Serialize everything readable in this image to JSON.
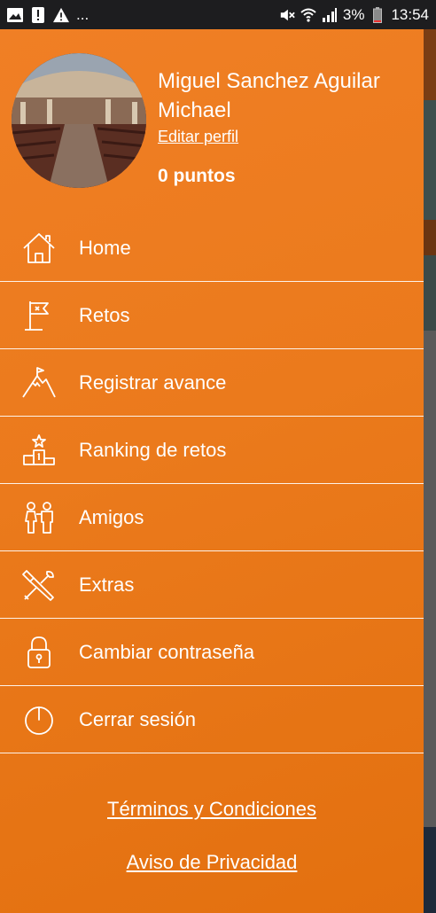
{
  "status_bar": {
    "battery": "3%",
    "time": "13:54",
    "ellipsis": "..."
  },
  "profile": {
    "name": "Miguel Sanchez Aguilar Michael",
    "edit_label": "Editar perfil",
    "points": "0 puntos"
  },
  "menu": [
    {
      "label": "Home",
      "icon": "home-icon"
    },
    {
      "label": "Retos",
      "icon": "flag-icon"
    },
    {
      "label": "Registrar avance",
      "icon": "mountain-icon"
    },
    {
      "label": "Ranking de retos",
      "icon": "podium-icon"
    },
    {
      "label": "Amigos",
      "icon": "friends-icon"
    },
    {
      "label": "Extras",
      "icon": "tools-icon"
    },
    {
      "label": "Cambiar contraseña",
      "icon": "lock-icon"
    },
    {
      "label": "Cerrar sesión",
      "icon": "power-icon"
    }
  ],
  "footer": {
    "terms": "Términos y Condiciones",
    "privacy": "Aviso de Privacidad"
  },
  "colors": {
    "drawer": "#eb7a1c",
    "status_bar": "#1d1d1f",
    "text": "#ffffff"
  }
}
